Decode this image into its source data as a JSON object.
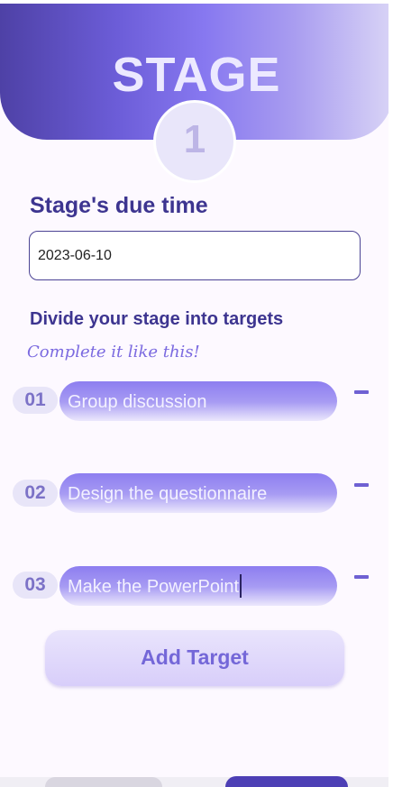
{
  "header": {
    "title": "STAGE",
    "stage_number": "1"
  },
  "due_time": {
    "label": "Stage's due time",
    "value": "2023-06-10"
  },
  "targets_section": {
    "label": "Divide your stage into targets",
    "hint": "Complete it like this!"
  },
  "targets": [
    {
      "number": "01",
      "text": "Group discussion"
    },
    {
      "number": "02",
      "text": "Design the questionnaire"
    },
    {
      "number": "03",
      "text": "Make the PowerPoint"
    }
  ],
  "add_target": {
    "label": "Add Target"
  },
  "colors": {
    "brand_primary": "#6c5dd8",
    "heading": "#3d3590",
    "hint": "#7b6ae0",
    "remove": "#6f61d3"
  },
  "icons": {
    "remove": "minus-icon"
  }
}
